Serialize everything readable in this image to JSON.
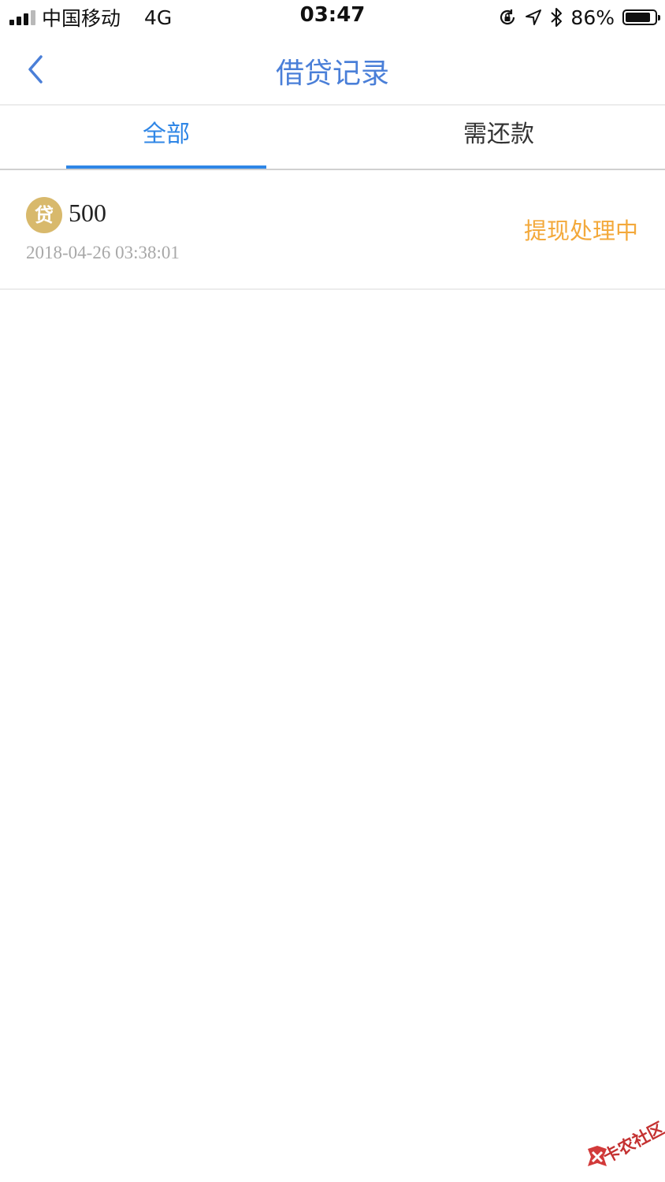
{
  "status_bar": {
    "carrier": "中国移动",
    "network": "4G",
    "time": "03:47",
    "battery_text": "86%",
    "battery_level": 0.86
  },
  "nav": {
    "title": "借贷记录",
    "back_icon": "chevron-left-icon"
  },
  "tabs": [
    {
      "label": "全部",
      "active": true
    },
    {
      "label": "需还款",
      "active": false
    }
  ],
  "records": [
    {
      "badge": "贷",
      "amount": "500",
      "datetime": "2018-04-26 03:38:01",
      "status": "提现处理中"
    }
  ],
  "watermark": {
    "text": "卡农社区"
  },
  "colors": {
    "accent": "#2f86e6",
    "title": "#4a7fd8",
    "status": "#f3a93b",
    "coin": "#d8b96c"
  }
}
